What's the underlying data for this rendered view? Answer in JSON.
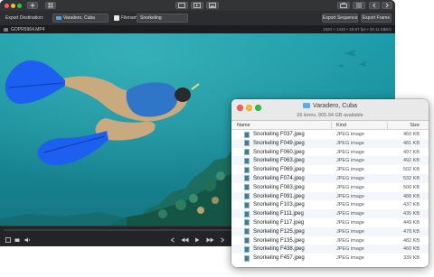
{
  "player": {
    "toolbar": {
      "export_destination_label": "Export Destination:",
      "export_destination_value": "Varadero, Cuba",
      "filename_label": "Filename:",
      "filename_value": "Snorkeling",
      "export_sequence_label": "Export Sequence",
      "export_frame_label": "Export Frame"
    },
    "infobar": {
      "filename": "GOPR5964.MP4",
      "meta": "1920 × 1440 • 29.97 fps • 30.11 Mbit/s"
    },
    "playback_progress": 0.0,
    "icons": [
      "add-icon",
      "grid-icon",
      "play-window-icon",
      "image-icon",
      "export-icon",
      "list-icon",
      "back-icon",
      "forward-icon",
      "prev-frame-icon",
      "rewind-icon",
      "play-icon",
      "forward-frame-icon",
      "fullscreen-icon",
      "volume-icon"
    ]
  },
  "finder": {
    "title": "Varadero, Cuba",
    "status": "26 items, 805.94 GB available",
    "columns": {
      "name": "Name",
      "kind": "Kind",
      "size": "Size"
    },
    "files": [
      {
        "name": "Snorkeling F037.jpeg",
        "kind": "JPEG image",
        "size": "460 KB"
      },
      {
        "name": "Snorkeling F049.jpeg",
        "kind": "JPEG image",
        "size": "481 KB"
      },
      {
        "name": "Snorkeling F060.jpeg",
        "kind": "JPEG image",
        "size": "497 KB"
      },
      {
        "name": "Snorkeling F063.jpeg",
        "kind": "JPEG image",
        "size": "492 KB"
      },
      {
        "name": "Snorkeling F069.jpeg",
        "kind": "JPEG image",
        "size": "502 KB"
      },
      {
        "name": "Snorkeling F074.jpeg",
        "kind": "JPEG image",
        "size": "532 KB"
      },
      {
        "name": "Snorkeling F083.jpeg",
        "kind": "JPEG image",
        "size": "500 KB"
      },
      {
        "name": "Snorkeling F091.jpeg",
        "kind": "JPEG image",
        "size": "488 KB"
      },
      {
        "name": "Snorkeling F103.jpeg",
        "kind": "JPEG image",
        "size": "437 KB"
      },
      {
        "name": "Snorkeling F111.jpeg",
        "kind": "JPEG image",
        "size": "435 KB"
      },
      {
        "name": "Snorkeling F117.jpeg",
        "kind": "JPEG image",
        "size": "449 KB"
      },
      {
        "name": "Snorkeling F125.jpeg",
        "kind": "JPEG image",
        "size": "478 KB"
      },
      {
        "name": "Snorkeling F135.jpeg",
        "kind": "JPEG image",
        "size": "482 KB"
      },
      {
        "name": "Snorkeling F438.jpeg",
        "kind": "JPEG image",
        "size": "460 KB"
      },
      {
        "name": "Snorkeling F457.jpeg",
        "kind": "JPEG image",
        "size": "339 KB"
      }
    ]
  },
  "colors": {
    "folder_blue": "#5aaef0",
    "water": "#1f8fa0",
    "fin_blue": "#1d5ff0"
  }
}
